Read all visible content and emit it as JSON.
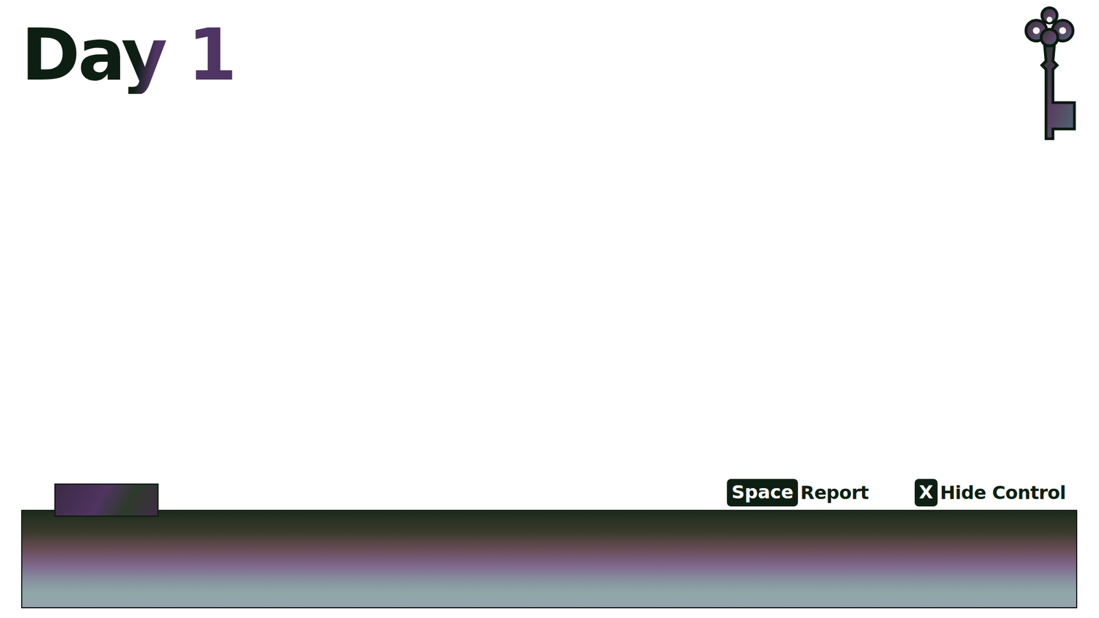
{
  "title": "Day 1",
  "controls": [
    {
      "key": "Space",
      "label": "Report"
    },
    {
      "key": "X",
      "label": "Hide Control"
    }
  ]
}
